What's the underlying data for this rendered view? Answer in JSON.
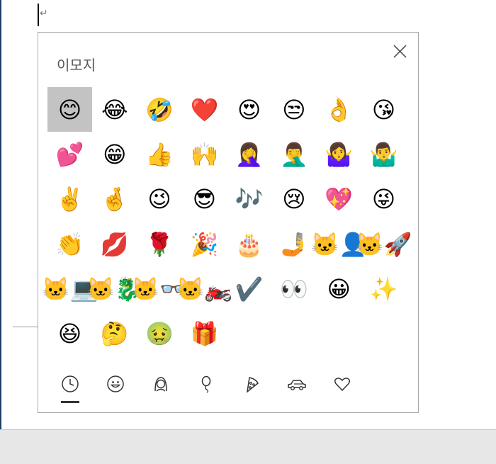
{
  "document": {
    "paragraph_mark": "↵"
  },
  "emoji_panel": {
    "title": "이모지",
    "close_icon": "close-icon",
    "selected_index": 0,
    "emojis": [
      {
        "char": "😊",
        "name": "smiling-face-with-smiling-eyes"
      },
      {
        "char": "😂",
        "name": "face-with-tears-of-joy"
      },
      {
        "char": "🤣",
        "name": "rolling-on-the-floor-laughing"
      },
      {
        "char": "❤️",
        "name": "red-heart"
      },
      {
        "char": "😍",
        "name": "smiling-face-with-heart-eyes"
      },
      {
        "char": "😒",
        "name": "unamused-face"
      },
      {
        "char": "👌",
        "name": "ok-hand"
      },
      {
        "char": "😘",
        "name": "face-blowing-a-kiss"
      },
      {
        "char": "💕",
        "name": "two-hearts"
      },
      {
        "char": "😁",
        "name": "beaming-face-with-smiling-eyes"
      },
      {
        "char": "👍",
        "name": "thumbs-up"
      },
      {
        "char": "🙌",
        "name": "raising-hands"
      },
      {
        "char": "🤦‍♀️",
        "name": "woman-facepalming"
      },
      {
        "char": "🤦‍♂️",
        "name": "man-facepalming"
      },
      {
        "char": "🤷‍♀️",
        "name": "woman-shrugging"
      },
      {
        "char": "🤷‍♂️",
        "name": "man-shrugging"
      },
      {
        "char": "✌️",
        "name": "victory-hand"
      },
      {
        "char": "🤞",
        "name": "crossed-fingers"
      },
      {
        "char": "😉",
        "name": "winking-face"
      },
      {
        "char": "😎",
        "name": "smiling-face-with-sunglasses"
      },
      {
        "char": "🎶",
        "name": "musical-notes"
      },
      {
        "char": "😢",
        "name": "crying-face"
      },
      {
        "char": "💖",
        "name": "sparkling-heart"
      },
      {
        "char": "😜",
        "name": "winking-face-with-tongue"
      },
      {
        "char": "👏",
        "name": "clapping-hands"
      },
      {
        "char": "💋",
        "name": "kiss-mark"
      },
      {
        "char": "🌹",
        "name": "rose"
      },
      {
        "char": "🎉",
        "name": "party-popper"
      },
      {
        "char": "🎂",
        "name": "birthday-cake"
      },
      {
        "char": "🤳",
        "name": "selfie"
      },
      {
        "char": "🐱‍👤",
        "name": "ninja-cat"
      },
      {
        "char": "🐱‍🚀",
        "name": "astro-cat"
      },
      {
        "char": "🐱‍💻",
        "name": "hacker-cat"
      },
      {
        "char": "🐱‍🐉",
        "name": "dino-cat"
      },
      {
        "char": "🐱‍👓",
        "name": "hipster-cat"
      },
      {
        "char": "🐱‍🏍",
        "name": "stunt-cat"
      },
      {
        "char": "✔️",
        "name": "check-mark"
      },
      {
        "char": "👀",
        "name": "eyes"
      },
      {
        "char": "😀",
        "name": "grinning-face"
      },
      {
        "char": "✨",
        "name": "sparkles"
      },
      {
        "char": "😆",
        "name": "grinning-squinting-face"
      },
      {
        "char": "🤔",
        "name": "thinking-face"
      },
      {
        "char": "🤢",
        "name": "nauseated-face"
      },
      {
        "char": "🎁",
        "name": "wrapped-gift"
      }
    ],
    "categories": [
      {
        "name": "recent",
        "icon": "clock-icon",
        "active": true
      },
      {
        "name": "smileys",
        "icon": "smiley-icon",
        "active": false
      },
      {
        "name": "people",
        "icon": "person-icon",
        "active": false
      },
      {
        "name": "celebration",
        "icon": "balloon-icon",
        "active": false
      },
      {
        "name": "food",
        "icon": "pizza-icon",
        "active": false
      },
      {
        "name": "travel",
        "icon": "car-icon",
        "active": false
      },
      {
        "name": "symbols",
        "icon": "heart-icon",
        "active": false
      }
    ]
  }
}
